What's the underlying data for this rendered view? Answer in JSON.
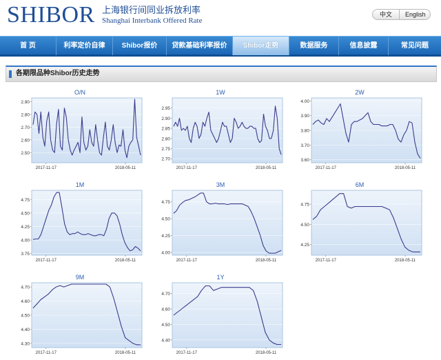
{
  "header": {
    "logo_main": "SHIBOR",
    "logo_cn": "上海银行间同业拆放利率",
    "logo_en": "Shanghai Interbank Offered Rate",
    "lang_cn": "中文",
    "lang_en": "English"
  },
  "nav": {
    "items": [
      "首 页",
      "利率定价自律",
      "Shibor报价",
      "贷款基础利率报价",
      "Shibor走势",
      "数据服务",
      "信息披露",
      "常见问题"
    ],
    "active_index": 4
  },
  "section": {
    "title": "各期限品种Shibor历史走势"
  },
  "colors": {
    "line": "#3b3b8c",
    "plot_bg_top": "#eef4fb",
    "plot_bg_bottom": "#cfe0f3",
    "nav": "#2a78c8",
    "title": "#2a5db0"
  },
  "chart_data": [
    {
      "type": "line",
      "title": "O/N",
      "xlabel": "",
      "ylabel": "",
      "x_start_label": "2017-11-17",
      "x_end_label": "2018-05-11",
      "ylim": [
        2.42,
        2.93
      ],
      "yticks": [
        "2.90",
        "2.80",
        "2.70",
        "2.60",
        "2.50"
      ],
      "ytick_values": [
        2.9,
        2.8,
        2.7,
        2.6,
        2.5
      ],
      "values": [
        2.72,
        2.82,
        2.8,
        2.65,
        2.82,
        2.62,
        2.55,
        2.75,
        2.82,
        2.6,
        2.52,
        2.5,
        2.72,
        2.84,
        2.55,
        2.52,
        2.85,
        2.78,
        2.6,
        2.52,
        2.48,
        2.52,
        2.55,
        2.58,
        2.5,
        2.78,
        2.58,
        2.52,
        2.55,
        2.68,
        2.58,
        2.55,
        2.72,
        2.6,
        2.5,
        2.48,
        2.62,
        2.74,
        2.55,
        2.52,
        2.6,
        2.72,
        2.58,
        2.5,
        2.56,
        2.55,
        2.68,
        2.52,
        2.46,
        2.55,
        2.58,
        2.6,
        2.92,
        2.62,
        2.55,
        2.48
      ]
    },
    {
      "type": "line",
      "title": "1W",
      "xlabel": "",
      "ylabel": "",
      "x_start_label": "2017-11-17",
      "x_end_label": "2018-05-11",
      "ylim": [
        2.68,
        3.0
      ],
      "yticks": [
        "2.95",
        "2.90",
        "2.85",
        "2.80",
        "2.75",
        "2.70"
      ],
      "ytick_values": [
        2.95,
        2.9,
        2.85,
        2.8,
        2.75,
        2.7
      ],
      "values": [
        2.86,
        2.88,
        2.86,
        2.9,
        2.84,
        2.85,
        2.84,
        2.86,
        2.8,
        2.78,
        2.85,
        2.88,
        2.86,
        2.8,
        2.82,
        2.88,
        2.86,
        2.9,
        2.93,
        2.84,
        2.82,
        2.8,
        2.78,
        2.8,
        2.84,
        2.88,
        2.86,
        2.86,
        2.82,
        2.78,
        2.8,
        2.9,
        2.88,
        2.85,
        2.86,
        2.88,
        2.86,
        2.85,
        2.85,
        2.86,
        2.86,
        2.85,
        2.85,
        2.8,
        2.78,
        2.79,
        2.92,
        2.86,
        2.84,
        2.8,
        2.8,
        2.84,
        2.96,
        2.9,
        2.75,
        2.72
      ]
    },
    {
      "type": "line",
      "title": "2W",
      "xlabel": "",
      "ylabel": "",
      "x_start_label": "2017-11-17",
      "x_end_label": "2018-05-11",
      "ylim": [
        3.58,
        4.02
      ],
      "yticks": [
        "4.00",
        "3.90",
        "3.80",
        "3.70",
        "3.60"
      ],
      "ytick_values": [
        4.0,
        3.9,
        3.8,
        3.7,
        3.6
      ],
      "values": [
        3.84,
        3.86,
        3.87,
        3.85,
        3.84,
        3.88,
        3.86,
        3.89,
        3.92,
        3.95,
        3.98,
        3.88,
        3.78,
        3.72,
        3.84,
        3.86,
        3.86,
        3.87,
        3.88,
        3.9,
        3.92,
        3.86,
        3.84,
        3.84,
        3.84,
        3.83,
        3.83,
        3.83,
        3.84,
        3.84,
        3.8,
        3.74,
        3.72,
        3.77,
        3.8,
        3.86,
        3.85,
        3.72,
        3.64,
        3.61
      ]
    },
    {
      "type": "line",
      "title": "1M",
      "xlabel": "",
      "ylabel": "",
      "x_start_label": "2017-11-17",
      "x_end_label": "2018-05-11",
      "ylim": [
        3.72,
        4.92
      ],
      "yticks": [
        "4.75",
        "4.50",
        "4.25",
        "4.00",
        "3.75"
      ],
      "ytick_values": [
        4.75,
        4.5,
        4.25,
        4.0,
        3.75
      ],
      "values": [
        4.01,
        4.02,
        4.02,
        4.1,
        4.25,
        4.4,
        4.55,
        4.65,
        4.8,
        4.88,
        4.88,
        4.6,
        4.3,
        4.15,
        4.1,
        4.12,
        4.12,
        4.15,
        4.12,
        4.1,
        4.1,
        4.12,
        4.1,
        4.08,
        4.08,
        4.1,
        4.1,
        4.08,
        4.2,
        4.4,
        4.5,
        4.5,
        4.45,
        4.3,
        4.1,
        3.95,
        3.86,
        3.8,
        3.82,
        3.88,
        3.85,
        3.8
      ]
    },
    {
      "type": "line",
      "title": "3M",
      "xlabel": "",
      "ylabel": "",
      "x_start_label": "2017-11-17",
      "x_end_label": "2018-05-11",
      "ylim": [
        3.96,
        4.92
      ],
      "yticks": [
        "4.75",
        "4.50",
        "4.25",
        "4.00"
      ],
      "ytick_values": [
        4.75,
        4.5,
        4.25,
        4.0
      ],
      "values": [
        4.58,
        4.62,
        4.7,
        4.74,
        4.77,
        4.78,
        4.8,
        4.82,
        4.85,
        4.88,
        4.88,
        4.75,
        4.72,
        4.72,
        4.73,
        4.72,
        4.72,
        4.72,
        4.71,
        4.72,
        4.72,
        4.72,
        4.72,
        4.72,
        4.7,
        4.68,
        4.6,
        4.5,
        4.38,
        4.25,
        4.1,
        4.02,
        3.99,
        3.99,
        3.99,
        4.01,
        4.03
      ]
    },
    {
      "type": "line",
      "title": "6M",
      "xlabel": "",
      "ylabel": "",
      "x_start_label": "2017-11-17",
      "x_end_label": "2018-05-11",
      "ylim": [
        4.12,
        4.92
      ],
      "yticks": [
        "4.75",
        "4.50",
        "4.25"
      ],
      "ytick_values": [
        4.75,
        4.5,
        4.25
      ],
      "values": [
        4.56,
        4.6,
        4.68,
        4.72,
        4.76,
        4.8,
        4.84,
        4.88,
        4.88,
        4.72,
        4.7,
        4.72,
        4.72,
        4.72,
        4.72,
        4.72,
        4.72,
        4.72,
        4.72,
        4.7,
        4.68,
        4.58,
        4.45,
        4.32,
        4.22,
        4.18,
        4.16,
        4.16,
        4.16
      ]
    },
    {
      "type": "line",
      "title": "9M",
      "xlabel": "",
      "ylabel": "",
      "x_start_label": "2017-11-17",
      "x_end_label": "2018-05-11",
      "ylim": [
        4.27,
        4.73
      ],
      "yticks": [
        "4.70",
        "4.60",
        "4.50",
        "4.40",
        "4.30"
      ],
      "ytick_values": [
        4.7,
        4.6,
        4.5,
        4.4,
        4.3
      ],
      "values": [
        4.55,
        4.58,
        4.61,
        4.63,
        4.65,
        4.68,
        4.7,
        4.71,
        4.7,
        4.71,
        4.72,
        4.72,
        4.72,
        4.72,
        4.72,
        4.72,
        4.72,
        4.72,
        4.72,
        4.72,
        4.7,
        4.62,
        4.52,
        4.42,
        4.34,
        4.32,
        4.3,
        4.29,
        4.29
      ]
    },
    {
      "type": "line",
      "title": "1Y",
      "xlabel": "",
      "ylabel": "",
      "x_start_label": "2017-11-17",
      "x_end_label": "2018-05-11",
      "ylim": [
        4.35,
        4.77
      ],
      "yticks": [
        "4.70",
        "4.60",
        "4.50",
        "4.40"
      ],
      "ytick_values": [
        4.7,
        4.6,
        4.5,
        4.4
      ],
      "values": [
        4.56,
        4.58,
        4.6,
        4.62,
        4.64,
        4.66,
        4.68,
        4.72,
        4.75,
        4.75,
        4.72,
        4.73,
        4.74,
        4.74,
        4.74,
        4.74,
        4.74,
        4.74,
        4.74,
        4.74,
        4.72,
        4.65,
        4.55,
        4.45,
        4.4,
        4.38,
        4.37,
        4.37
      ]
    }
  ]
}
